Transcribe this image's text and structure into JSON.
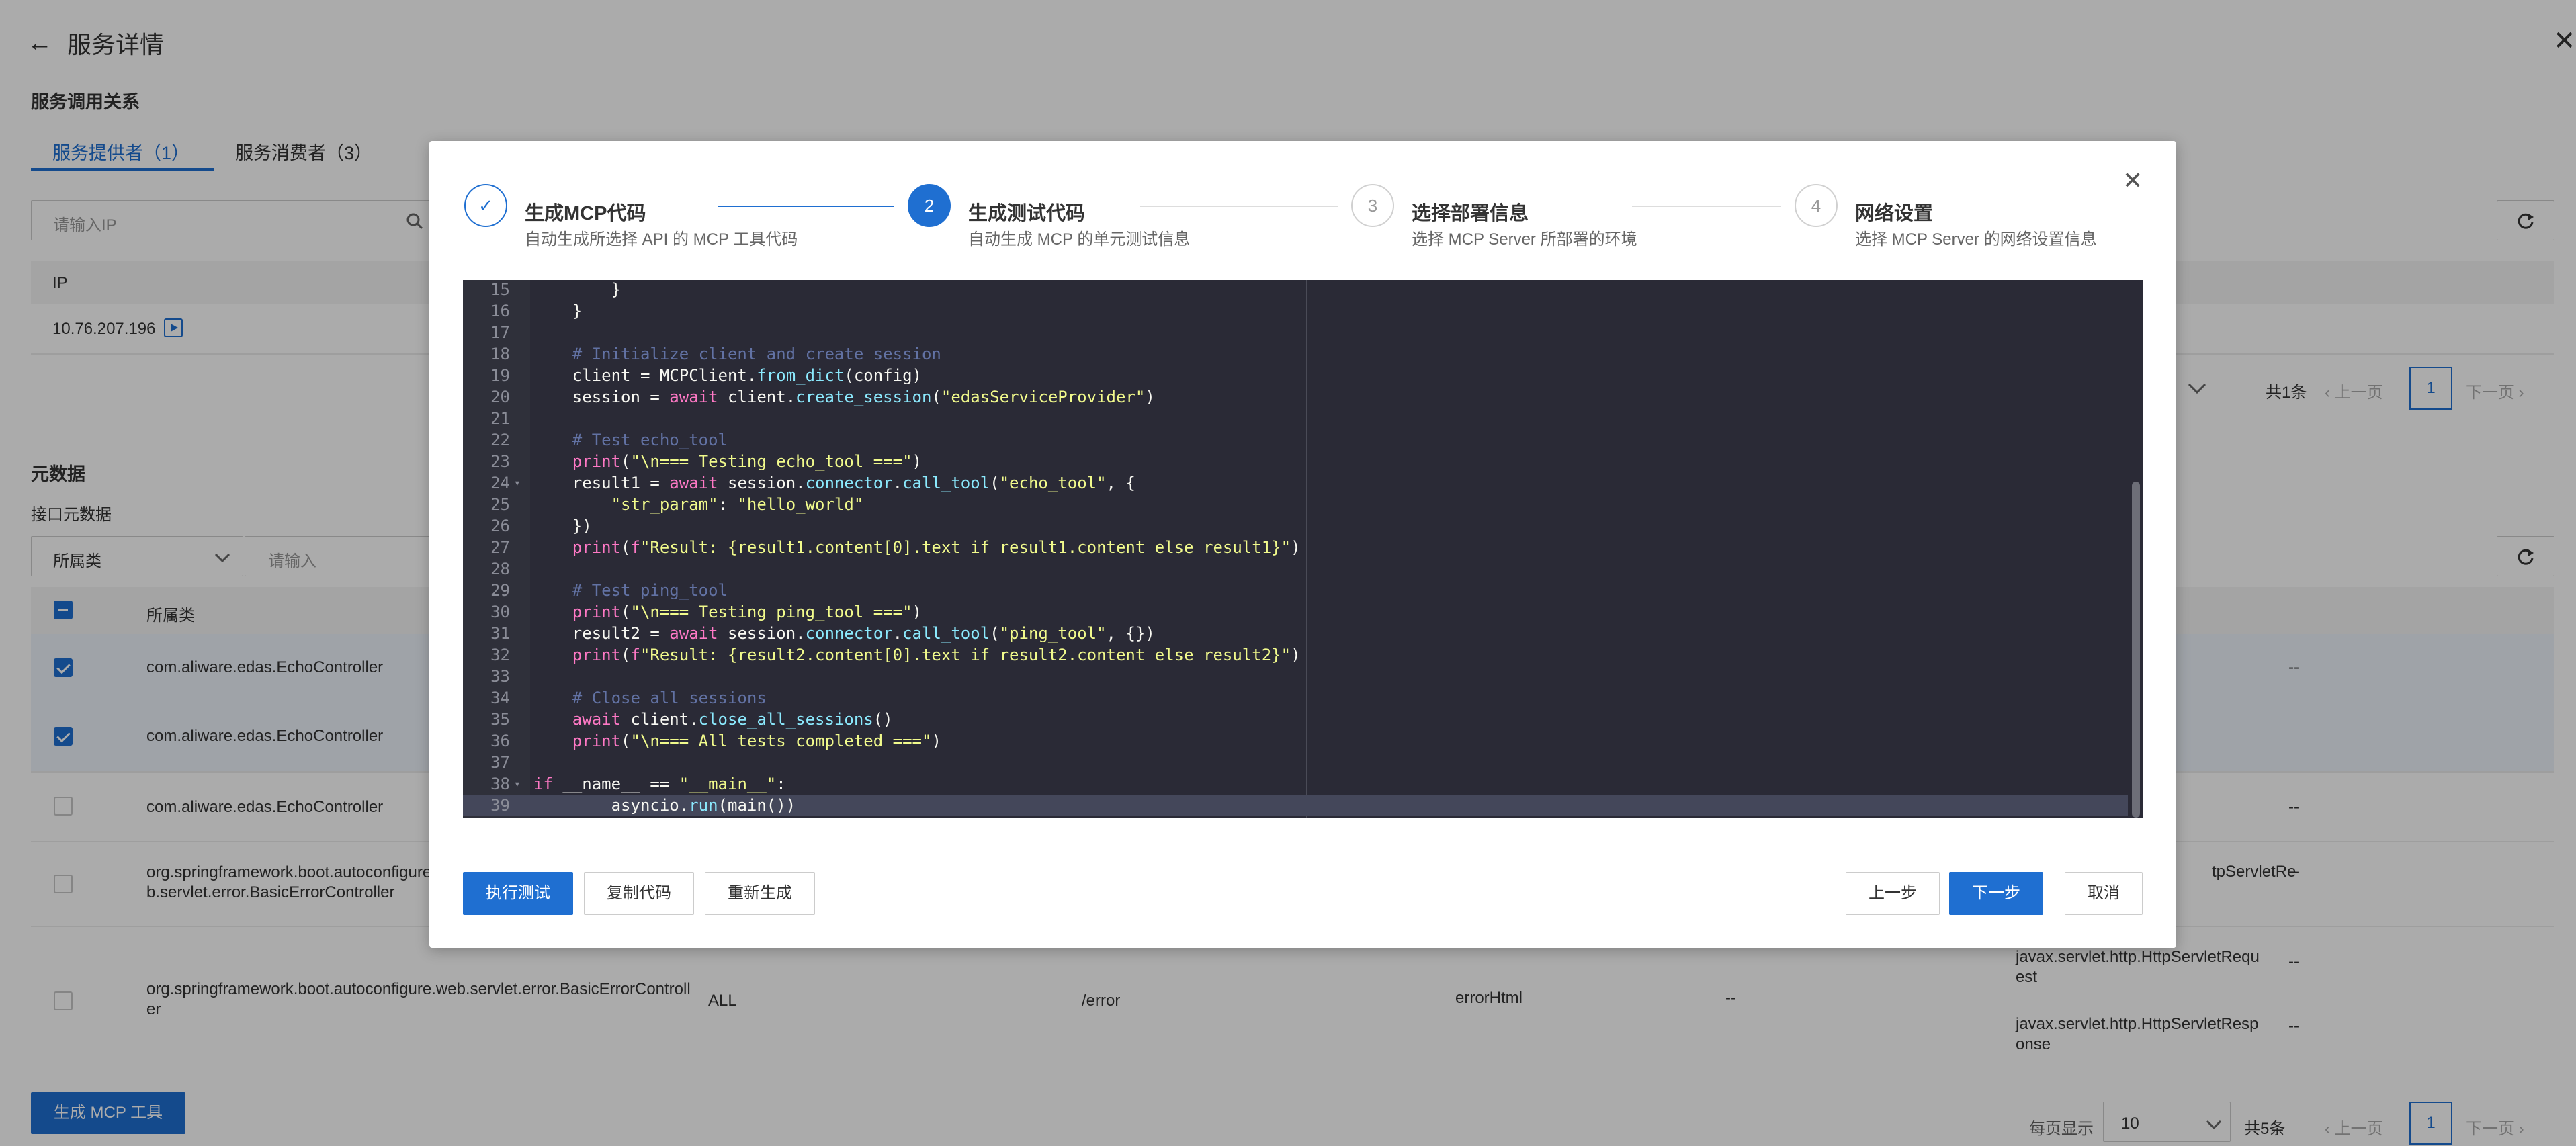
{
  "page": {
    "back_icon": "arrow-left-icon",
    "title": "服务详情",
    "close_icon": "close-icon"
  },
  "relations": {
    "title": "服务调用关系",
    "tabs": [
      {
        "label": "服务提供者（1）",
        "active": true
      },
      {
        "label": "服务消费者（3）",
        "active": false
      }
    ],
    "search_placeholder": "请输入IP",
    "table_header_ip": "IP",
    "rows": [
      {
        "ip": "10.76.207.196"
      }
    ],
    "pagination": {
      "total": "共1条",
      "prev": "上一页",
      "page": "1",
      "next": "下一页"
    }
  },
  "metadata": {
    "title": "元数据",
    "subtitle": "接口元数据",
    "filter_select": "所属类",
    "filter_placeholder": "请输入",
    "header_class": "所属类",
    "rows": [
      {
        "checked": true,
        "class": "com.aliware.edas.EchoController",
        "extra": "--"
      },
      {
        "checked": true,
        "class": "com.aliware.edas.EchoController",
        "extra": ""
      },
      {
        "checked": false,
        "class": "com.aliware.edas.EchoController",
        "extra": "--"
      },
      {
        "checked": false,
        "class": "org.springframework.boot.autoconfigure.web.servlet.error.BasicErrorController",
        "param": "tpServletRe",
        "extra": "--"
      },
      {
        "checked": false,
        "class": "org.springframework.boot.autoconfigure.web.servlet.error.BasicErrorController",
        "method": "ALL",
        "path": "/error",
        "name": "errorHtml",
        "dash": "--",
        "param1": "javax.servlet.http.HttpServletRequest",
        "param2": "javax.servlet.http.HttpServletResponse",
        "extra": "--",
        "extra2": "--"
      }
    ],
    "generate_button": "生成 MCP 工具",
    "pagination": {
      "page_size_label": "每页显示",
      "page_size": "10",
      "total": "共5条",
      "prev": "上一页",
      "page": "1",
      "next": "下一页"
    }
  },
  "modal": {
    "close_icon": "close-icon",
    "steps": [
      {
        "num": "✓",
        "title": "生成MCP代码",
        "desc": "自动生成所选择 API 的 MCP 工具代码",
        "state": "done"
      },
      {
        "num": "2",
        "title": "生成测试代码",
        "desc": "自动生成 MCP 的单元测试信息",
        "state": "active"
      },
      {
        "num": "3",
        "title": "选择部署信息",
        "desc": "选择 MCP Server 所部署的环境",
        "state": "wait"
      },
      {
        "num": "4",
        "title": "网络设置",
        "desc": "选择 MCP Server 的网络设置信息",
        "state": "wait"
      }
    ],
    "code_lines": [
      {
        "n": "15",
        "code": "    }"
      },
      {
        "n": "16",
        "code": "}"
      },
      {
        "n": "17",
        "code": ""
      },
      {
        "n": "18",
        "code": "# Initialize client and create session"
      },
      {
        "n": "19",
        "code": "client = MCPClient.from_dict(config)"
      },
      {
        "n": "20",
        "code": "session = await client.create_session(\"edasServiceProvider\")"
      },
      {
        "n": "21",
        "code": ""
      },
      {
        "n": "22",
        "code": "# Test echo_tool"
      },
      {
        "n": "23",
        "code": "print(\"\\n=== Testing echo_tool ===\")"
      },
      {
        "n": "24",
        "code": "result1 = await session.connector.call_tool(\"echo_tool\", {"
      },
      {
        "n": "25",
        "code": "    \"str_param\": \"hello_world\""
      },
      {
        "n": "26",
        "code": "})"
      },
      {
        "n": "27",
        "code": "print(f\"Result: {result1.content[0].text if result1.content else result1}\")"
      },
      {
        "n": "28",
        "code": ""
      },
      {
        "n": "29",
        "code": "# Test ping_tool"
      },
      {
        "n": "30",
        "code": "print(\"\\n=== Testing ping_tool ===\")"
      },
      {
        "n": "31",
        "code": "result2 = await session.connector.call_tool(\"ping_tool\", {})"
      },
      {
        "n": "32",
        "code": "print(f\"Result: {result2.content[0].text if result2.content else result2}\")"
      },
      {
        "n": "33",
        "code": ""
      },
      {
        "n": "34",
        "code": "# Close all sessions"
      },
      {
        "n": "35",
        "code": "await client.close_all_sessions()"
      },
      {
        "n": "36",
        "code": "print(\"\\n=== All tests completed ===\")"
      },
      {
        "n": "37",
        "code": ""
      },
      {
        "n": "38",
        "code": "if __name__ == \"__main__\":"
      },
      {
        "n": "39",
        "code": "    asyncio.run(main())"
      }
    ],
    "buttons": {
      "run": "执行测试",
      "copy": "复制代码",
      "regenerate": "重新生成",
      "prev": "上一步",
      "next": "下一步",
      "cancel": "取消"
    }
  },
  "colors": {
    "primary": "#1f6fd1",
    "editor_bg": "#2a2a36",
    "overlay": "rgba(0,0,0,0.33)"
  }
}
